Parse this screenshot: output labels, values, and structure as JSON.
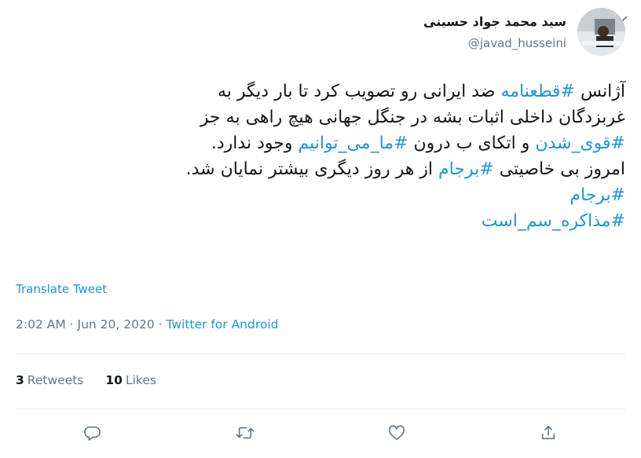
{
  "author": {
    "display_name": "سید محمد جواد حسینی",
    "handle": "@javad_husseini"
  },
  "tweet": {
    "lines": [
      [
        {
          "t": "آژانس "
        },
        {
          "t": "#قطعنامه",
          "tag": true
        },
        {
          "t": " ضد ایرانی رو تصویب کرد تا بار دیگر به"
        }
      ],
      [
        {
          "t": "غربزدگان داخلی اثبات بشه در جنگل جهانی هیچ راهی به جز"
        }
      ],
      [
        {
          "t": "#قوی_شدن",
          "tag": true
        },
        {
          "t": " و اتکای ب درون "
        },
        {
          "t": "#ما_می_توانیم",
          "tag": true
        },
        {
          "t": " وجود ندارد."
        }
      ],
      [
        {
          "t": "امروز بی خاصیتی "
        },
        {
          "t": "#برجام",
          "tag": true
        },
        {
          "t": " از هر روز دیگری بیشتر نمایان شد."
        }
      ],
      [
        {
          "t": "#برجام",
          "tag": true
        }
      ],
      [
        {
          "t": "#مذاکره_سم_است",
          "tag": true
        }
      ]
    ]
  },
  "translate_label": "Translate Tweet",
  "meta": {
    "time": "2:02 AM",
    "separator": " · ",
    "date": "Jun 20, 2020",
    "source": "Twitter for Android"
  },
  "stats": {
    "retweets_count": "3",
    "retweets_label": "Retweets",
    "likes_count": "10",
    "likes_label": "Likes"
  },
  "icons": {
    "reply": "reply-icon",
    "retweet": "retweet-icon",
    "like": "like-icon",
    "share": "share-icon",
    "more": "chevron-down-icon"
  },
  "colors": {
    "link": "#1b95e0",
    "secondary_text": "#657786",
    "primary_text": "#14171a",
    "divider": "#e6ecf0"
  }
}
